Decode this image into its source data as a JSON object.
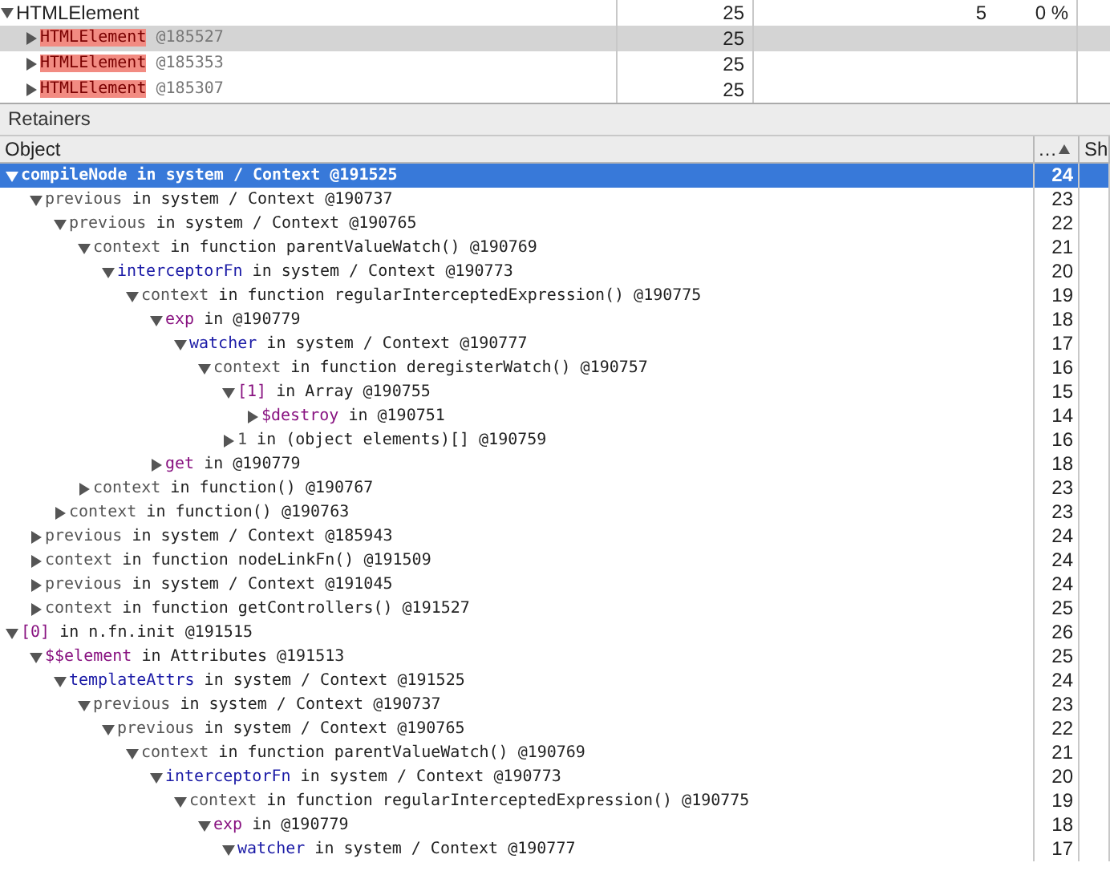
{
  "constructors": [
    {
      "name": "HTMLElement",
      "expanded": true,
      "distance": "25",
      "shallow_size": "5",
      "retained_size": "0 %",
      "children": [
        {
          "name": "HTMLElement",
          "id": "@185527",
          "distance": "25",
          "selected": true,
          "expanded": false
        },
        {
          "name": "HTMLElement",
          "id": "@185353",
          "distance": "25",
          "selected": false,
          "expanded": false
        },
        {
          "name": "HTMLElement",
          "id": "@185307",
          "distance": "25",
          "selected": false,
          "expanded": false
        }
      ]
    }
  ],
  "retainers": {
    "title": "Retainers",
    "columns": [
      {
        "label": "Object",
        "sorted": false
      },
      {
        "label": "…",
        "sorted": true
      },
      {
        "label": "Sh",
        "sorted": false
      }
    ],
    "rows": [
      {
        "name": "compileNode",
        "kind": "closure",
        "rest": " in system / Context @191525",
        "distance": "24",
        "expanded": true,
        "selected": true,
        "children": [
          {
            "name": "previous",
            "kind": "internal",
            "rest": " in system / Context @190737",
            "distance": "23",
            "expanded": true,
            "selected": false,
            "children": [
              {
                "name": "previous",
                "kind": "internal",
                "rest": " in system / Context @190765",
                "distance": "22",
                "expanded": true,
                "selected": false,
                "children": [
                  {
                    "name": "context",
                    "kind": "internal",
                    "rest": " in function parentValueWatch() @190769",
                    "distance": "21",
                    "expanded": true,
                    "selected": false,
                    "children": [
                      {
                        "name": "interceptorFn",
                        "kind": "closure",
                        "rest": " in system / Context @190773",
                        "distance": "20",
                        "expanded": true,
                        "selected": false,
                        "children": [
                          {
                            "name": "context",
                            "kind": "internal",
                            "rest": " in function regularInterceptedExpression() @190775",
                            "distance": "19",
                            "expanded": true,
                            "selected": false,
                            "children": [
                              {
                                "name": "exp",
                                "kind": "property",
                                "rest": " in @190779",
                                "distance": "18",
                                "expanded": true,
                                "selected": false,
                                "children": [
                                  {
                                    "name": "watcher",
                                    "kind": "closure",
                                    "rest": " in system / Context @190777",
                                    "distance": "17",
                                    "expanded": true,
                                    "selected": false,
                                    "children": [
                                      {
                                        "name": "context",
                                        "kind": "internal",
                                        "rest": " in function deregisterWatch() @190757",
                                        "distance": "16",
                                        "expanded": true,
                                        "selected": false,
                                        "children": [
                                          {
                                            "name": "[1]",
                                            "kind": "property",
                                            "rest": " in Array @190755",
                                            "distance": "15",
                                            "expanded": true,
                                            "selected": false,
                                            "children": [
                                              {
                                                "name": "$destroy",
                                                "kind": "property",
                                                "rest": " in @190751",
                                                "distance": "14",
                                                "expanded": false,
                                                "selected": false
                                              }
                                            ]
                                          },
                                          {
                                            "name": "1",
                                            "kind": "internal",
                                            "rest": " in (object elements)[] @190759",
                                            "distance": "16",
                                            "expanded": false,
                                            "selected": false
                                          }
                                        ]
                                      }
                                    ]
                                  }
                                ]
                              },
                              {
                                "name": "get",
                                "kind": "property",
                                "rest": " in @190779",
                                "distance": "18",
                                "expanded": false,
                                "selected": false
                              }
                            ]
                          }
                        ]
                      }
                    ]
                  },
                  {
                    "name": "context",
                    "kind": "internal",
                    "rest": " in function() @190767",
                    "distance": "23",
                    "expanded": false,
                    "selected": false
                  }
                ]
              },
              {
                "name": "context",
                "kind": "internal",
                "rest": " in function() @190763",
                "distance": "23",
                "expanded": false,
                "selected": false
              }
            ]
          },
          {
            "name": "previous",
            "kind": "internal",
            "rest": " in system / Context @185943",
            "distance": "24",
            "expanded": false,
            "selected": false
          },
          {
            "name": "context",
            "kind": "internal",
            "rest": " in function nodeLinkFn() @191509",
            "distance": "24",
            "expanded": false,
            "selected": false
          },
          {
            "name": "previous",
            "kind": "internal",
            "rest": " in system / Context @191045",
            "distance": "24",
            "expanded": false,
            "selected": false
          },
          {
            "name": "context",
            "kind": "internal",
            "rest": " in function getControllers() @191527",
            "distance": "25",
            "expanded": false,
            "selected": false
          }
        ]
      },
      {
        "name": "[0]",
        "kind": "property",
        "rest": " in n.fn.init @191515",
        "distance": "26",
        "expanded": true,
        "selected": false,
        "children": [
          {
            "name": "$$element",
            "kind": "property",
            "rest": " in Attributes @191513",
            "distance": "25",
            "expanded": true,
            "selected": false,
            "children": [
              {
                "name": "templateAttrs",
                "kind": "closure",
                "rest": " in system / Context @191525",
                "distance": "24",
                "expanded": true,
                "selected": false,
                "children": [
                  {
                    "name": "previous",
                    "kind": "internal",
                    "rest": " in system / Context @190737",
                    "distance": "23",
                    "expanded": true,
                    "selected": false,
                    "children": [
                      {
                        "name": "previous",
                        "kind": "internal",
                        "rest": " in system / Context @190765",
                        "distance": "22",
                        "expanded": true,
                        "selected": false,
                        "children": [
                          {
                            "name": "context",
                            "kind": "internal",
                            "rest": " in function parentValueWatch() @190769",
                            "distance": "21",
                            "expanded": true,
                            "selected": false,
                            "children": [
                              {
                                "name": "interceptorFn",
                                "kind": "closure",
                                "rest": " in system / Context @190773",
                                "distance": "20",
                                "expanded": true,
                                "selected": false,
                                "children": [
                                  {
                                    "name": "context",
                                    "kind": "internal",
                                    "rest": " in function regularInterceptedExpression() @190775",
                                    "distance": "19",
                                    "expanded": true,
                                    "selected": false,
                                    "children": [
                                      {
                                        "name": "exp",
                                        "kind": "property",
                                        "rest": " in @190779",
                                        "distance": "18",
                                        "expanded": true,
                                        "selected": false,
                                        "children": [
                                          {
                                            "name": "watcher",
                                            "kind": "closure",
                                            "rest": " in system / Context @190777",
                                            "distance": "17",
                                            "expanded": true,
                                            "selected": false
                                          }
                                        ]
                                      }
                                    ]
                                  }
                                ]
                              }
                            ]
                          }
                        ]
                      }
                    ]
                  }
                ]
              }
            ]
          }
        ]
      }
    ]
  }
}
